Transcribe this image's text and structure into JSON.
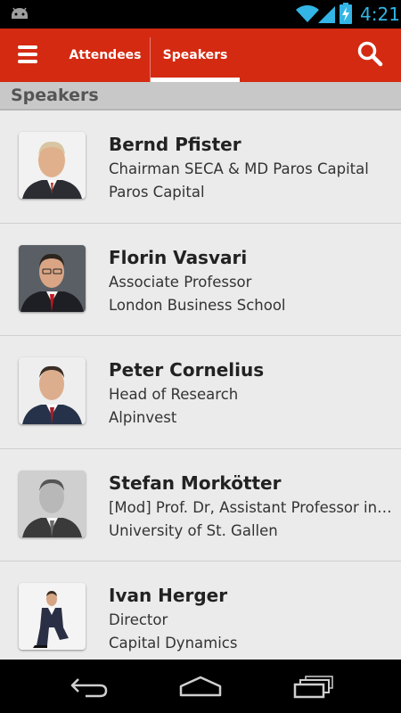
{
  "status_bar": {
    "time": "4:21",
    "icons": [
      "android-debug-icon",
      "wifi-icon",
      "signal-icon",
      "battery-charging-icon"
    ]
  },
  "action_bar": {
    "tabs": [
      {
        "label": "Attendees",
        "selected": false
      },
      {
        "label": "Speakers",
        "selected": true
      }
    ],
    "icons": [
      "menu-icon",
      "search-icon"
    ],
    "colors": {
      "background": "#d42a12",
      "indicator": "#ffffff"
    }
  },
  "section": {
    "title": "Speakers"
  },
  "speakers": [
    {
      "name": "Bernd Pfister",
      "title": "Chairman SECA & MD Paros Capital",
      "company": "Paros Capital"
    },
    {
      "name": "Florin Vasvari",
      "title": "Associate Professor",
      "company": "London Business School"
    },
    {
      "name": "Peter Cornelius",
      "title": "Head of Research",
      "company": "Alpinvest"
    },
    {
      "name": "Stefan Morkötter",
      "title": "[Mod] Prof. Dr, Assistant Professor in Banking",
      "company": "University of St. Gallen"
    },
    {
      "name": "Ivan Herger",
      "title": "Director",
      "company": "Capital Dynamics"
    }
  ],
  "nav_bar": {
    "icons": [
      "back-icon",
      "home-icon",
      "recent-apps-icon"
    ]
  }
}
